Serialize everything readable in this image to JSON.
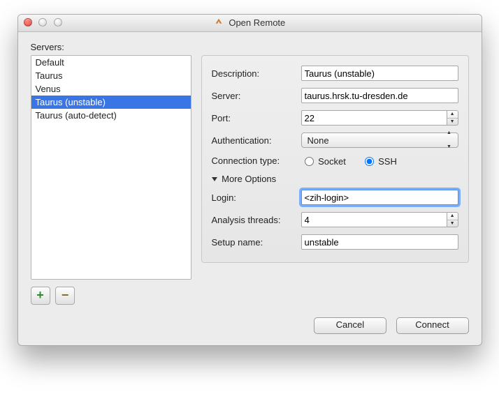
{
  "window": {
    "title": "Open Remote"
  },
  "servers_label": "Servers:",
  "servers": [
    {
      "label": "Default",
      "selected": false
    },
    {
      "label": "Taurus",
      "selected": false
    },
    {
      "label": "Venus",
      "selected": false
    },
    {
      "label": "Taurus (unstable)",
      "selected": true
    },
    {
      "label": "Taurus (auto-detect)",
      "selected": false
    }
  ],
  "list_buttons": {
    "add": "+",
    "remove": "−"
  },
  "form": {
    "description": {
      "label": "Description:",
      "value": "Taurus (unstable)"
    },
    "server": {
      "label": "Server:",
      "value": "taurus.hrsk.tu-dresden.de"
    },
    "port": {
      "label": "Port:",
      "value": "22"
    },
    "auth": {
      "label": "Authentication:",
      "value": "None"
    },
    "conn_type": {
      "label": "Connection type:",
      "options": {
        "socket": "Socket",
        "ssh": "SSH"
      },
      "selected": "ssh"
    },
    "more_options_label": "More Options",
    "login": {
      "label": "Login:",
      "value": "<zih-login>"
    },
    "threads": {
      "label": "Analysis threads:",
      "value": "4"
    },
    "setup": {
      "label": "Setup name:",
      "value": "unstable"
    }
  },
  "footer": {
    "cancel": "Cancel",
    "connect": "Connect"
  }
}
